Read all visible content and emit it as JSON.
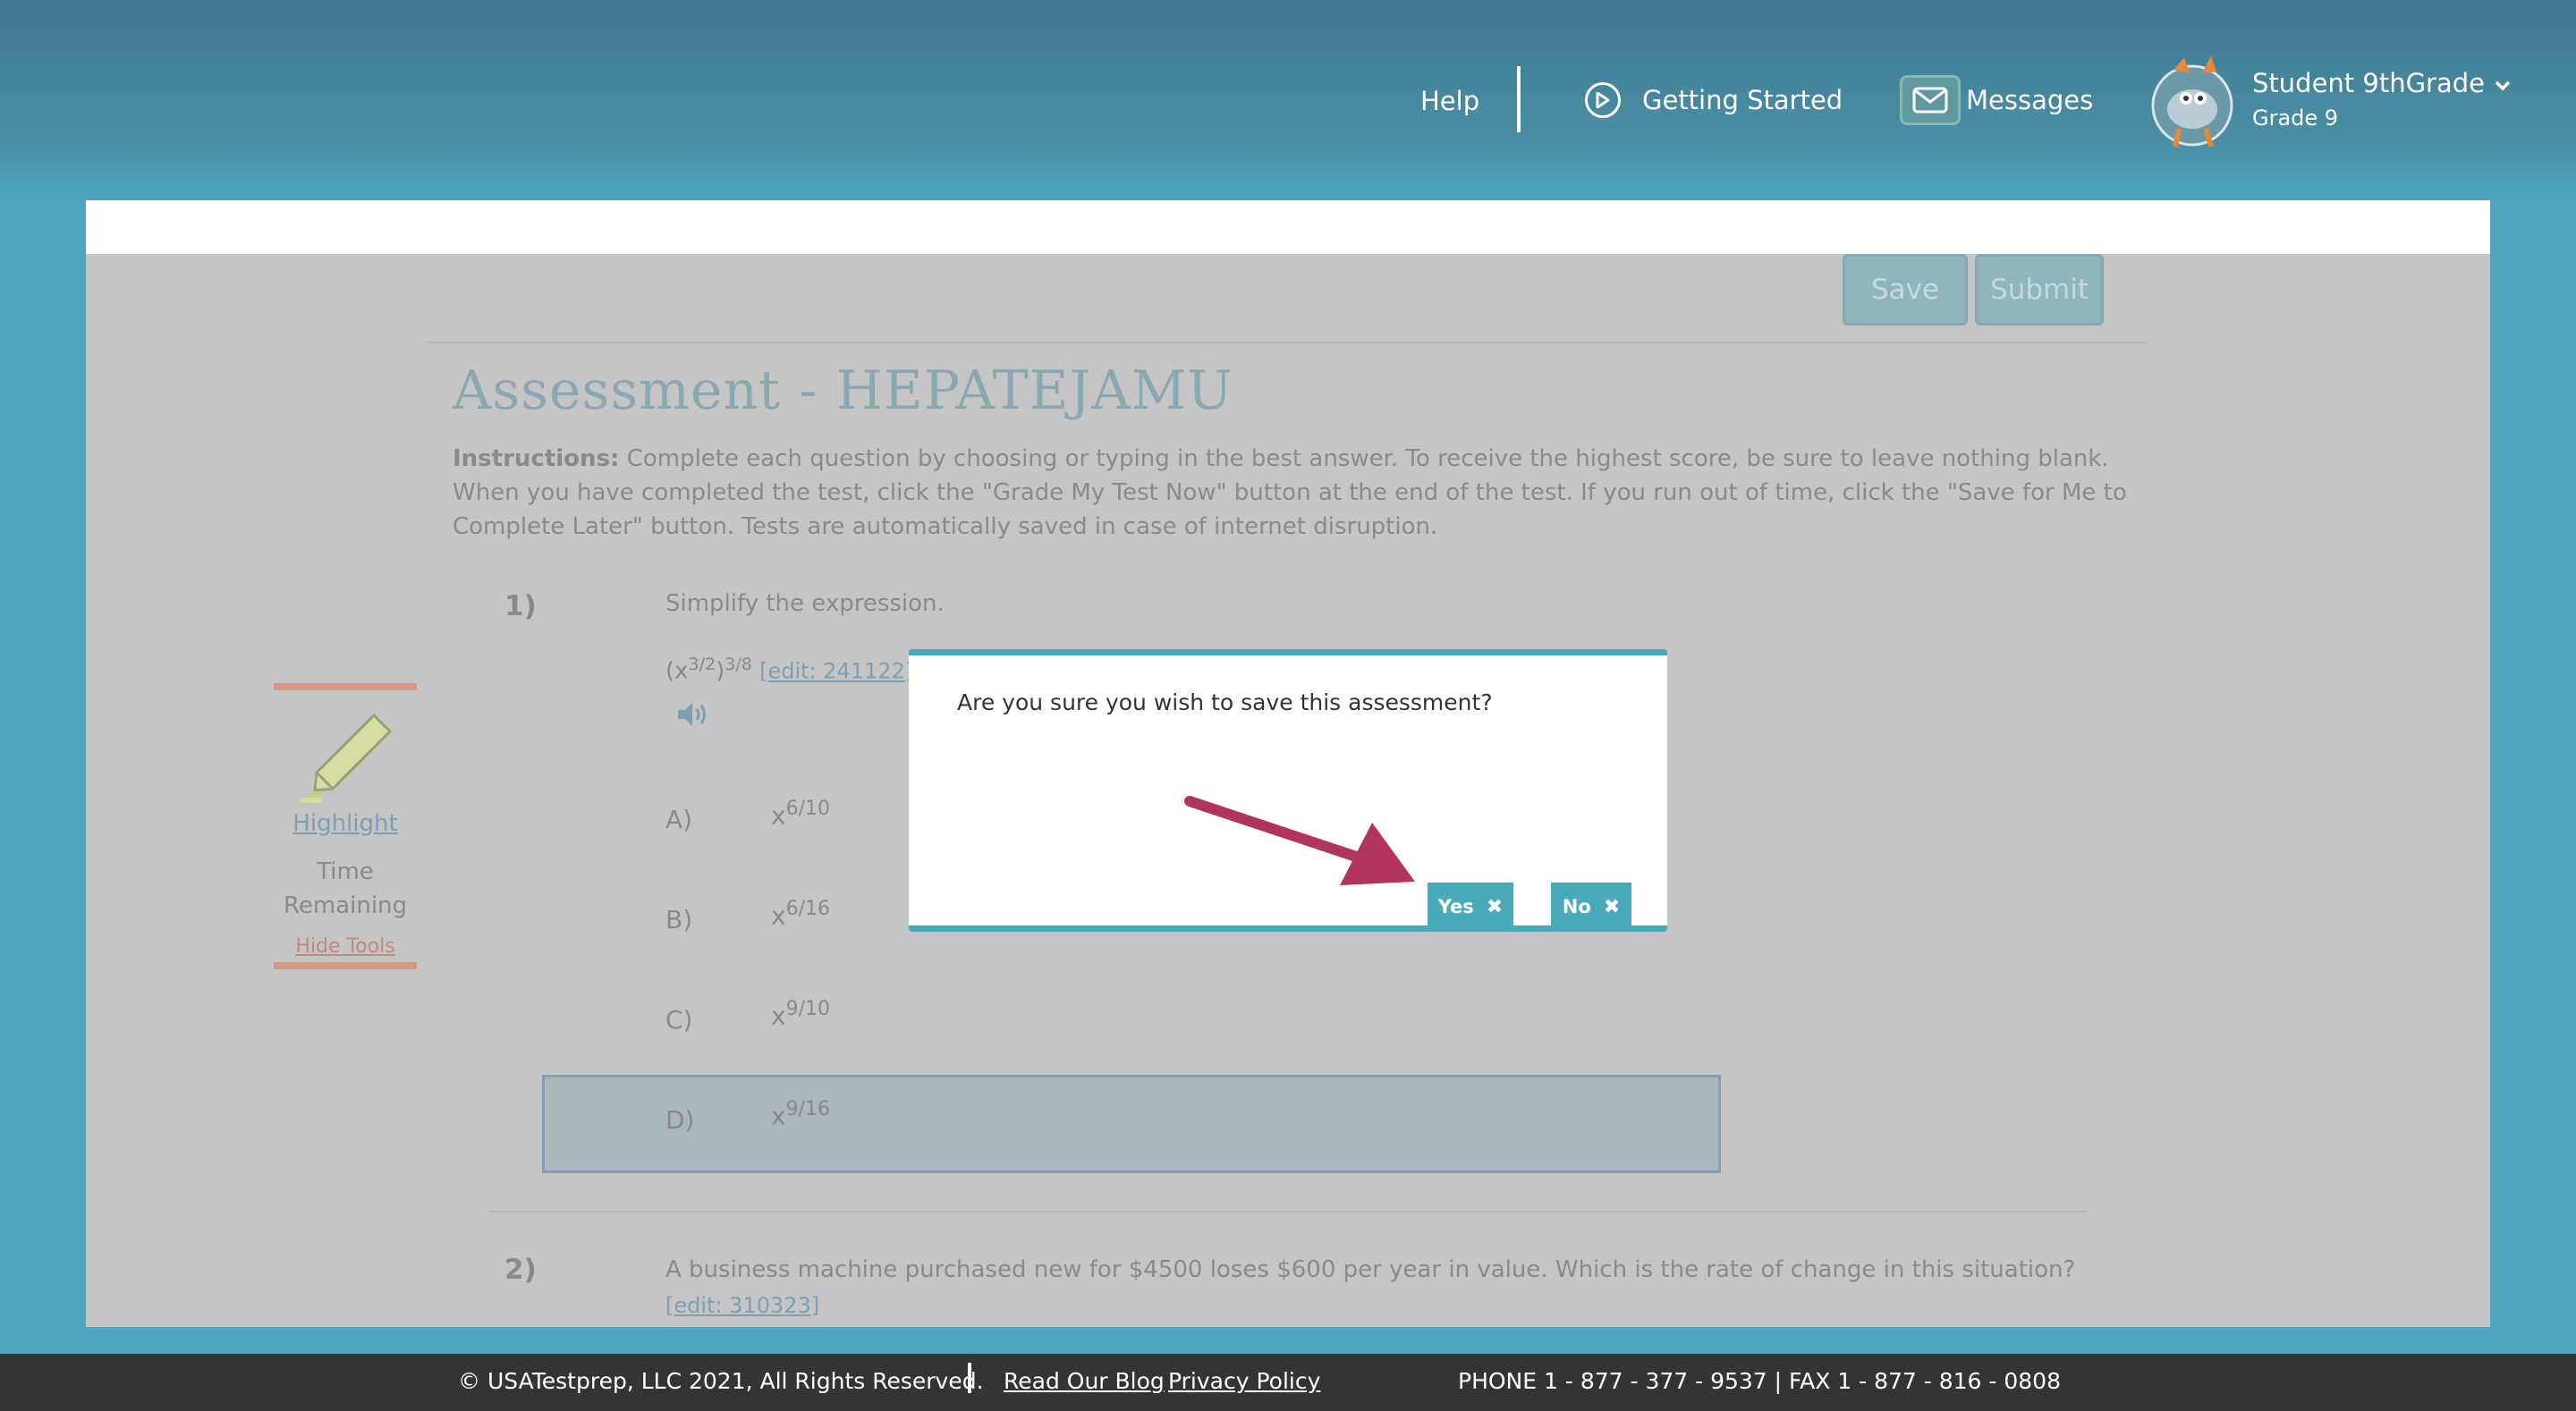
{
  "header": {
    "help_label": "Help",
    "getting_started_label": "Getting Started",
    "messages_label": "Messages",
    "user_name": "Student 9thGrade",
    "user_grade": "Grade 9"
  },
  "toolbar": {
    "save_label": "Save",
    "submit_label": "Submit"
  },
  "assessment": {
    "title": "Assessment - HEPATEJAMU",
    "instructions_label": "Instructions:",
    "instructions_text": "Complete each question by choosing or typing in the best answer. To receive the highest score, be sure to leave nothing blank. When you have completed the test, click the \"Grade My Test Now\" button at the end of the test. If you run out of time, click the \"Save for Me to Complete Later\" button. Tests are automatically saved in case of internet disruption."
  },
  "question1": {
    "number": "1)",
    "text": "Simplify the expression.",
    "expr_base": "(x",
    "expr_inner_exp": "3/2",
    "expr_close": ")",
    "expr_outer_exp": "3/8",
    "edit_link": "[edit: 241122]",
    "options": [
      {
        "letter": "A)",
        "base": "x",
        "exp": "6/10"
      },
      {
        "letter": "B)",
        "base": "x",
        "exp": "6/16"
      },
      {
        "letter": "C)",
        "base": "x",
        "exp": "9/10"
      },
      {
        "letter": "D)",
        "base": "x",
        "exp": "9/16"
      }
    ]
  },
  "question2": {
    "number": "2)",
    "text": "A business machine purchased new for $4500 loses $600 per year in value. Which is the rate of change in this situation?",
    "edit_link": "[edit: 310323]"
  },
  "tools": {
    "highlight_label": "Highlight",
    "time_label_1": "Time",
    "time_label_2": "Remaining",
    "hide_tools_label": "Hide Tools"
  },
  "modal": {
    "message": "Are you sure you wish to save this assessment?",
    "yes_label": "Yes",
    "no_label": "No"
  },
  "footer": {
    "copyright": "© USATestprep, LLC 2021, All Rights Reserved.",
    "blog_link": "Read Our Blog",
    "privacy_link": "Privacy Policy",
    "phone": "PHONE 1 - 877 - 377 - 9537 | FAX 1 - 877 - 816 - 0808"
  },
  "colors": {
    "accent": "#4aa9ba",
    "arrow": "#b0345c",
    "footer_bg": "#343434"
  }
}
